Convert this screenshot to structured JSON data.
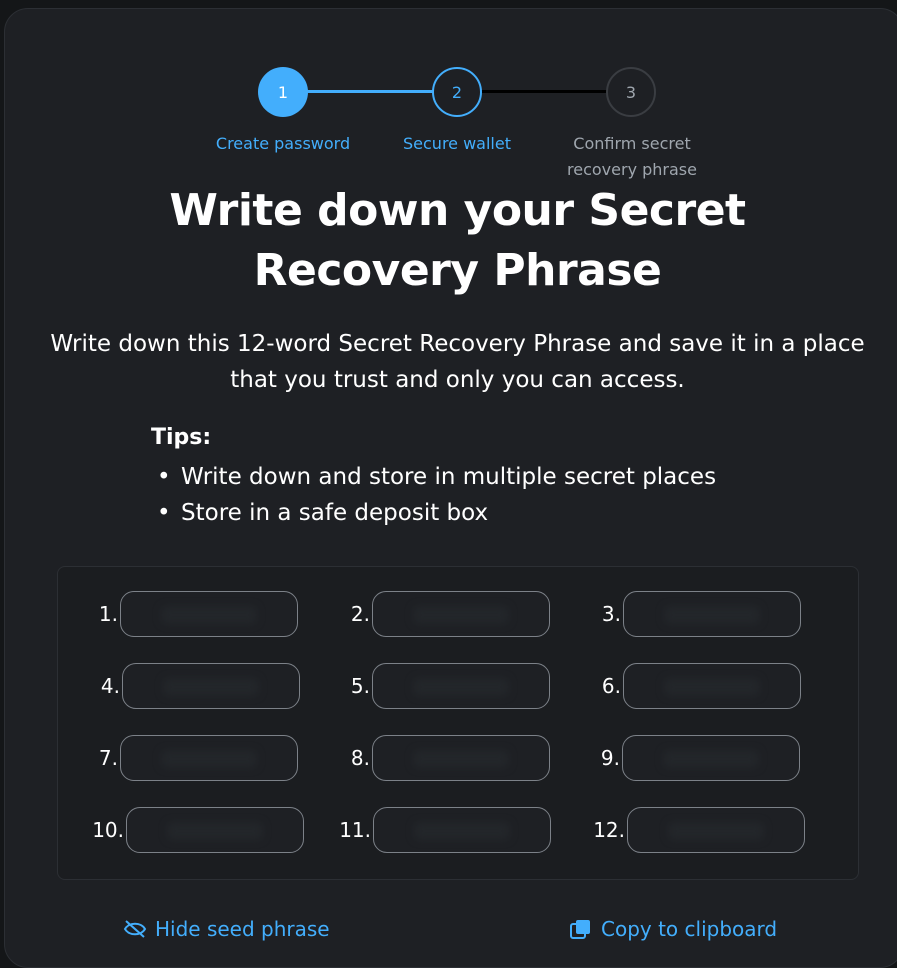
{
  "stepper": {
    "steps": [
      {
        "number": "1",
        "label": "Create password"
      },
      {
        "number": "2",
        "label": "Secure wallet"
      },
      {
        "number": "3",
        "label": "Confirm secret\nrecovery phrase"
      }
    ]
  },
  "title": "Write down your Secret Recovery Phrase",
  "description": "Write down this 12-word Secret Recovery Phrase and save it in a place that you trust and only you can access.",
  "tips": {
    "title": "Tips:",
    "items": [
      "Write down and store in multiple secret places",
      "Store in a safe deposit box"
    ]
  },
  "phrase": {
    "numbers": [
      "1.",
      "2.",
      "3.",
      "4.",
      "5.",
      "6.",
      "7.",
      "8.",
      "9.",
      "10.",
      "11.",
      "12."
    ]
  },
  "actions": {
    "hide_label": "Hide seed phrase",
    "copy_label": "Copy to clipboard"
  },
  "colors": {
    "accent": "#43aefc",
    "background": "#141618",
    "card": "#1e2024"
  }
}
